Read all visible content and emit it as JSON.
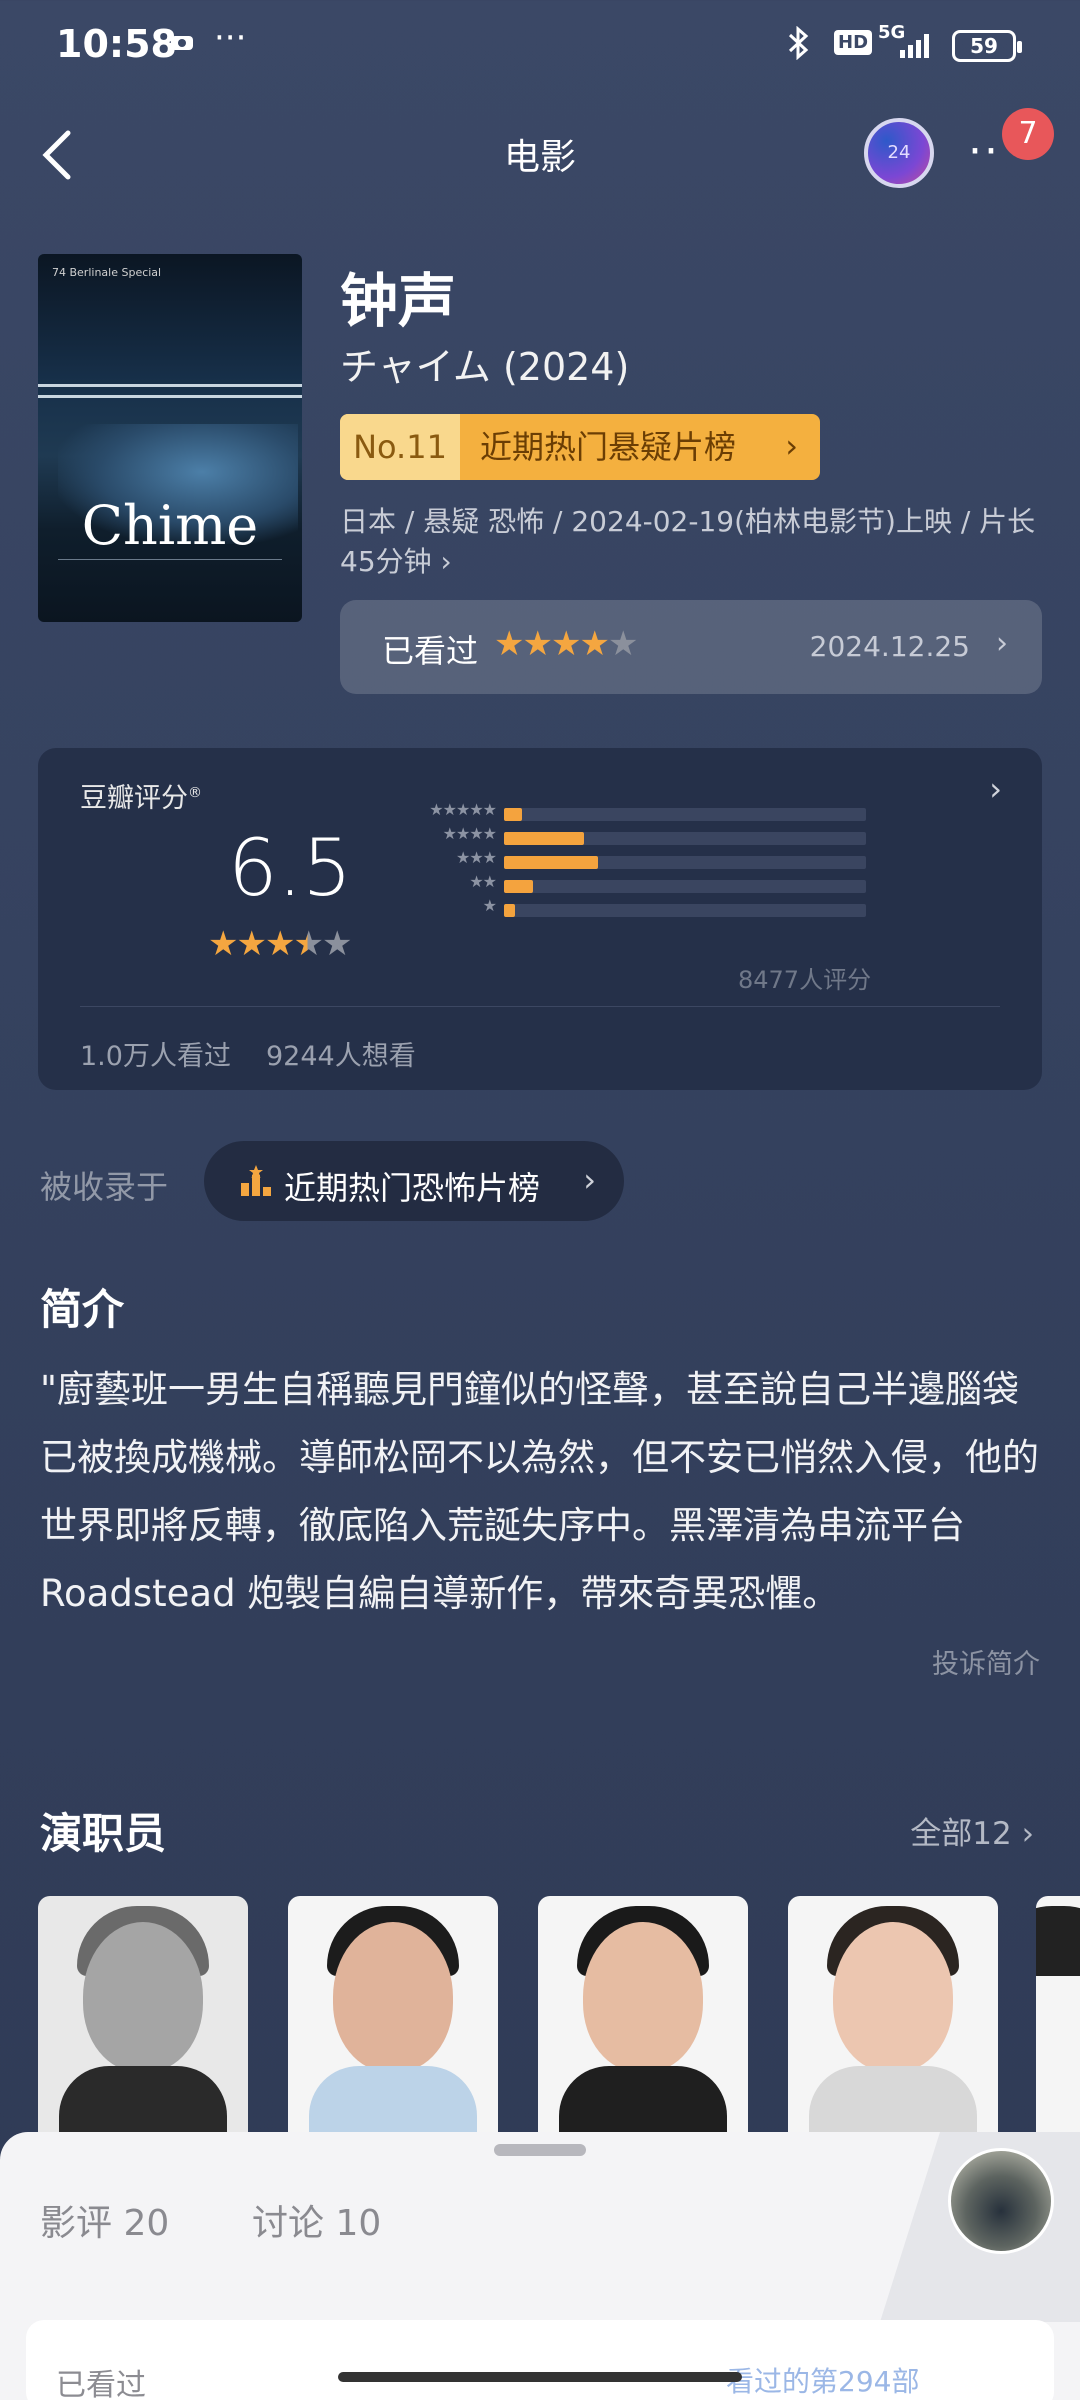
{
  "status_bar": {
    "time": "10:58",
    "icons": [
      "recording-icon",
      "more-dots-icon",
      "bluetooth-icon",
      "hd-icon",
      "5g-signal-icon",
      "battery-icon"
    ],
    "hd": "HD",
    "network": "5G",
    "battery": "59"
  },
  "header": {
    "title": "电影",
    "badge_count": "7",
    "avatar_text": "24"
  },
  "movie": {
    "title": "钟声",
    "original_title": "チャイム (2024)",
    "rank_no": "No.11",
    "rank_label": "近期热门悬疑片榜",
    "meta": "日本 / 悬疑 恐怖 / 2024-02-19(柏林电影节)上映 / 片长45分钟 ›",
    "poster_title": "Chime",
    "poster_festival": "74 Berlinale Special",
    "watched_label": "已看过",
    "watched_rating": 4,
    "watched_date": "2024.12.25"
  },
  "rating": {
    "label": "豆瓣评分",
    "score": "6.5",
    "score_stars": 3.5,
    "distribution_percent": [
      5,
      22,
      26,
      8,
      3
    ],
    "count": "8477人评分",
    "seen": "1.0万人看过",
    "want": "9244人想看"
  },
  "included": {
    "label": "被收录于",
    "list": "近期热门恐怖片榜"
  },
  "synopsis": {
    "title": "简介",
    "text": "\"廚藝班一男生自稱聽見門鐘似的怪聲，甚至說自己半邊腦袋已被換成機械。導師松岡不以為然，但不安已悄然入侵，他的世界即將反轉，徹底陷入荒誕失序中。黑澤清為串流平台Roadstead 炮製自編自導新作，帶來奇異恐懼。",
    "report": "投诉简介"
  },
  "cast": {
    "title": "演职员",
    "all_label": "全部12",
    "colors": {
      "skin": "#e2b49a",
      "hair": "#1e1e1e"
    }
  },
  "bottom_sheet": {
    "tab_reviews": "影评 20",
    "tab_discussion": "讨论 10",
    "card_left": "已看过",
    "card_right": "看过的第294部"
  },
  "colors": {
    "accent_star": "#f4a640",
    "rank_bg": "#f4b03f",
    "background": "#3b4866"
  }
}
